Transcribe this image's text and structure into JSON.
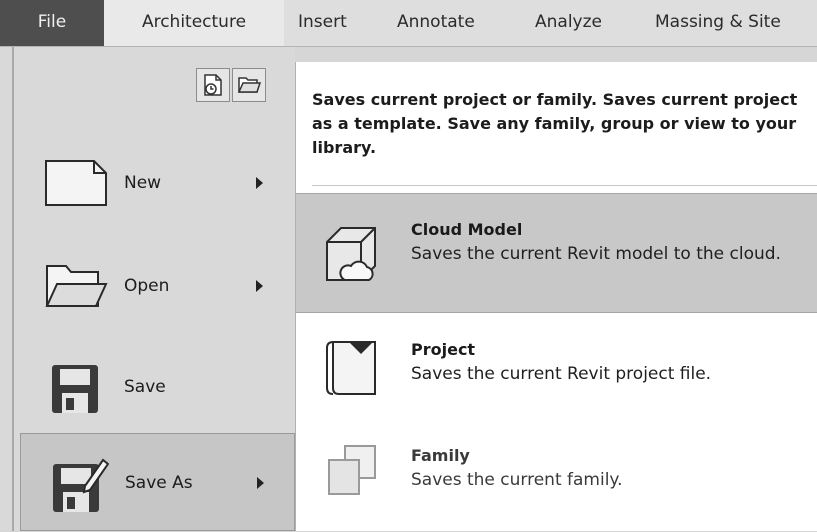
{
  "ribbon": {
    "tabs": [
      {
        "label": "File"
      },
      {
        "label": "Architecture"
      },
      {
        "label": "Insert"
      },
      {
        "label": "Annotate"
      },
      {
        "label": "Analyze"
      },
      {
        "label": "Massing & Site"
      }
    ]
  },
  "quick_icons": [
    {
      "icon": "recent-documents-icon"
    },
    {
      "icon": "open-documents-icon"
    }
  ],
  "menu": {
    "items": [
      {
        "label": "New",
        "icon": "new-document-icon",
        "has_submenu": true
      },
      {
        "label": "Open",
        "icon": "open-folder-icon",
        "has_submenu": true
      },
      {
        "label": "Save",
        "icon": "save-floppy-icon",
        "has_submenu": false
      },
      {
        "label": "Save As",
        "icon": "save-as-floppy-pencil-icon",
        "has_submenu": true,
        "selected": true
      }
    ]
  },
  "submenu": {
    "description": "Saves current project or family. Saves current project as a template. Save any family, group or view to your library.",
    "items": [
      {
        "title": "Cloud Model",
        "description": "Saves the current Revit model to the cloud.",
        "icon": "cloud-model-icon",
        "highlighted": true
      },
      {
        "title": "Project",
        "description": "Saves the current Revit project file.",
        "icon": "project-file-icon"
      },
      {
        "title": "Family",
        "description": "Saves the current family.",
        "icon": "family-icon"
      }
    ]
  },
  "colors": {
    "file_tab": "#4e4e4e",
    "highlight": "#c8c8c8",
    "pane_background": "#d9d9d9"
  }
}
